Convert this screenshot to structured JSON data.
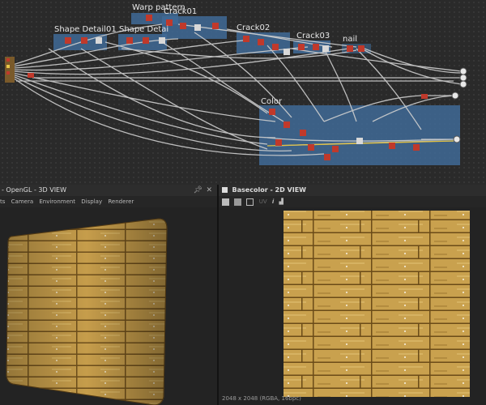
{
  "graph": {
    "frames": [
      {
        "id": "warp",
        "label": "Warp pattern"
      },
      {
        "id": "crack01",
        "label": "Crack01"
      },
      {
        "id": "shape1",
        "label": "Shape Detail01"
      },
      {
        "id": "shape2",
        "label": "Shape Detai"
      },
      {
        "id": "crack02",
        "label": "Crack02"
      },
      {
        "id": "crack03",
        "label": "Crack03"
      },
      {
        "id": "nail",
        "label": "nail"
      },
      {
        "id": "color",
        "label": "Color"
      }
    ],
    "frame_color": "#3f6a96",
    "wire_color": "#cfcfcf"
  },
  "view3d": {
    "title": "- OpenGL - 3D VIEW",
    "menu": [
      "ts",
      "Camera",
      "Environment",
      "Display",
      "Renderer"
    ]
  },
  "view2d": {
    "title": "Basecolor - 2D VIEW",
    "toolbar_label": "UV",
    "status": "2048 x 2048 (RGBA, 16bpc)"
  },
  "icons": [
    "pin-icon",
    "close-icon",
    "grid-icon",
    "save-icon",
    "save-as-icon",
    "dual-view-icon",
    "uv-icon",
    "info-icon",
    "histogram-icon"
  ],
  "colors": {
    "wood_light": "#c9a14e",
    "wood_dark": "#8a6627",
    "accent_node": "#c0392b"
  }
}
